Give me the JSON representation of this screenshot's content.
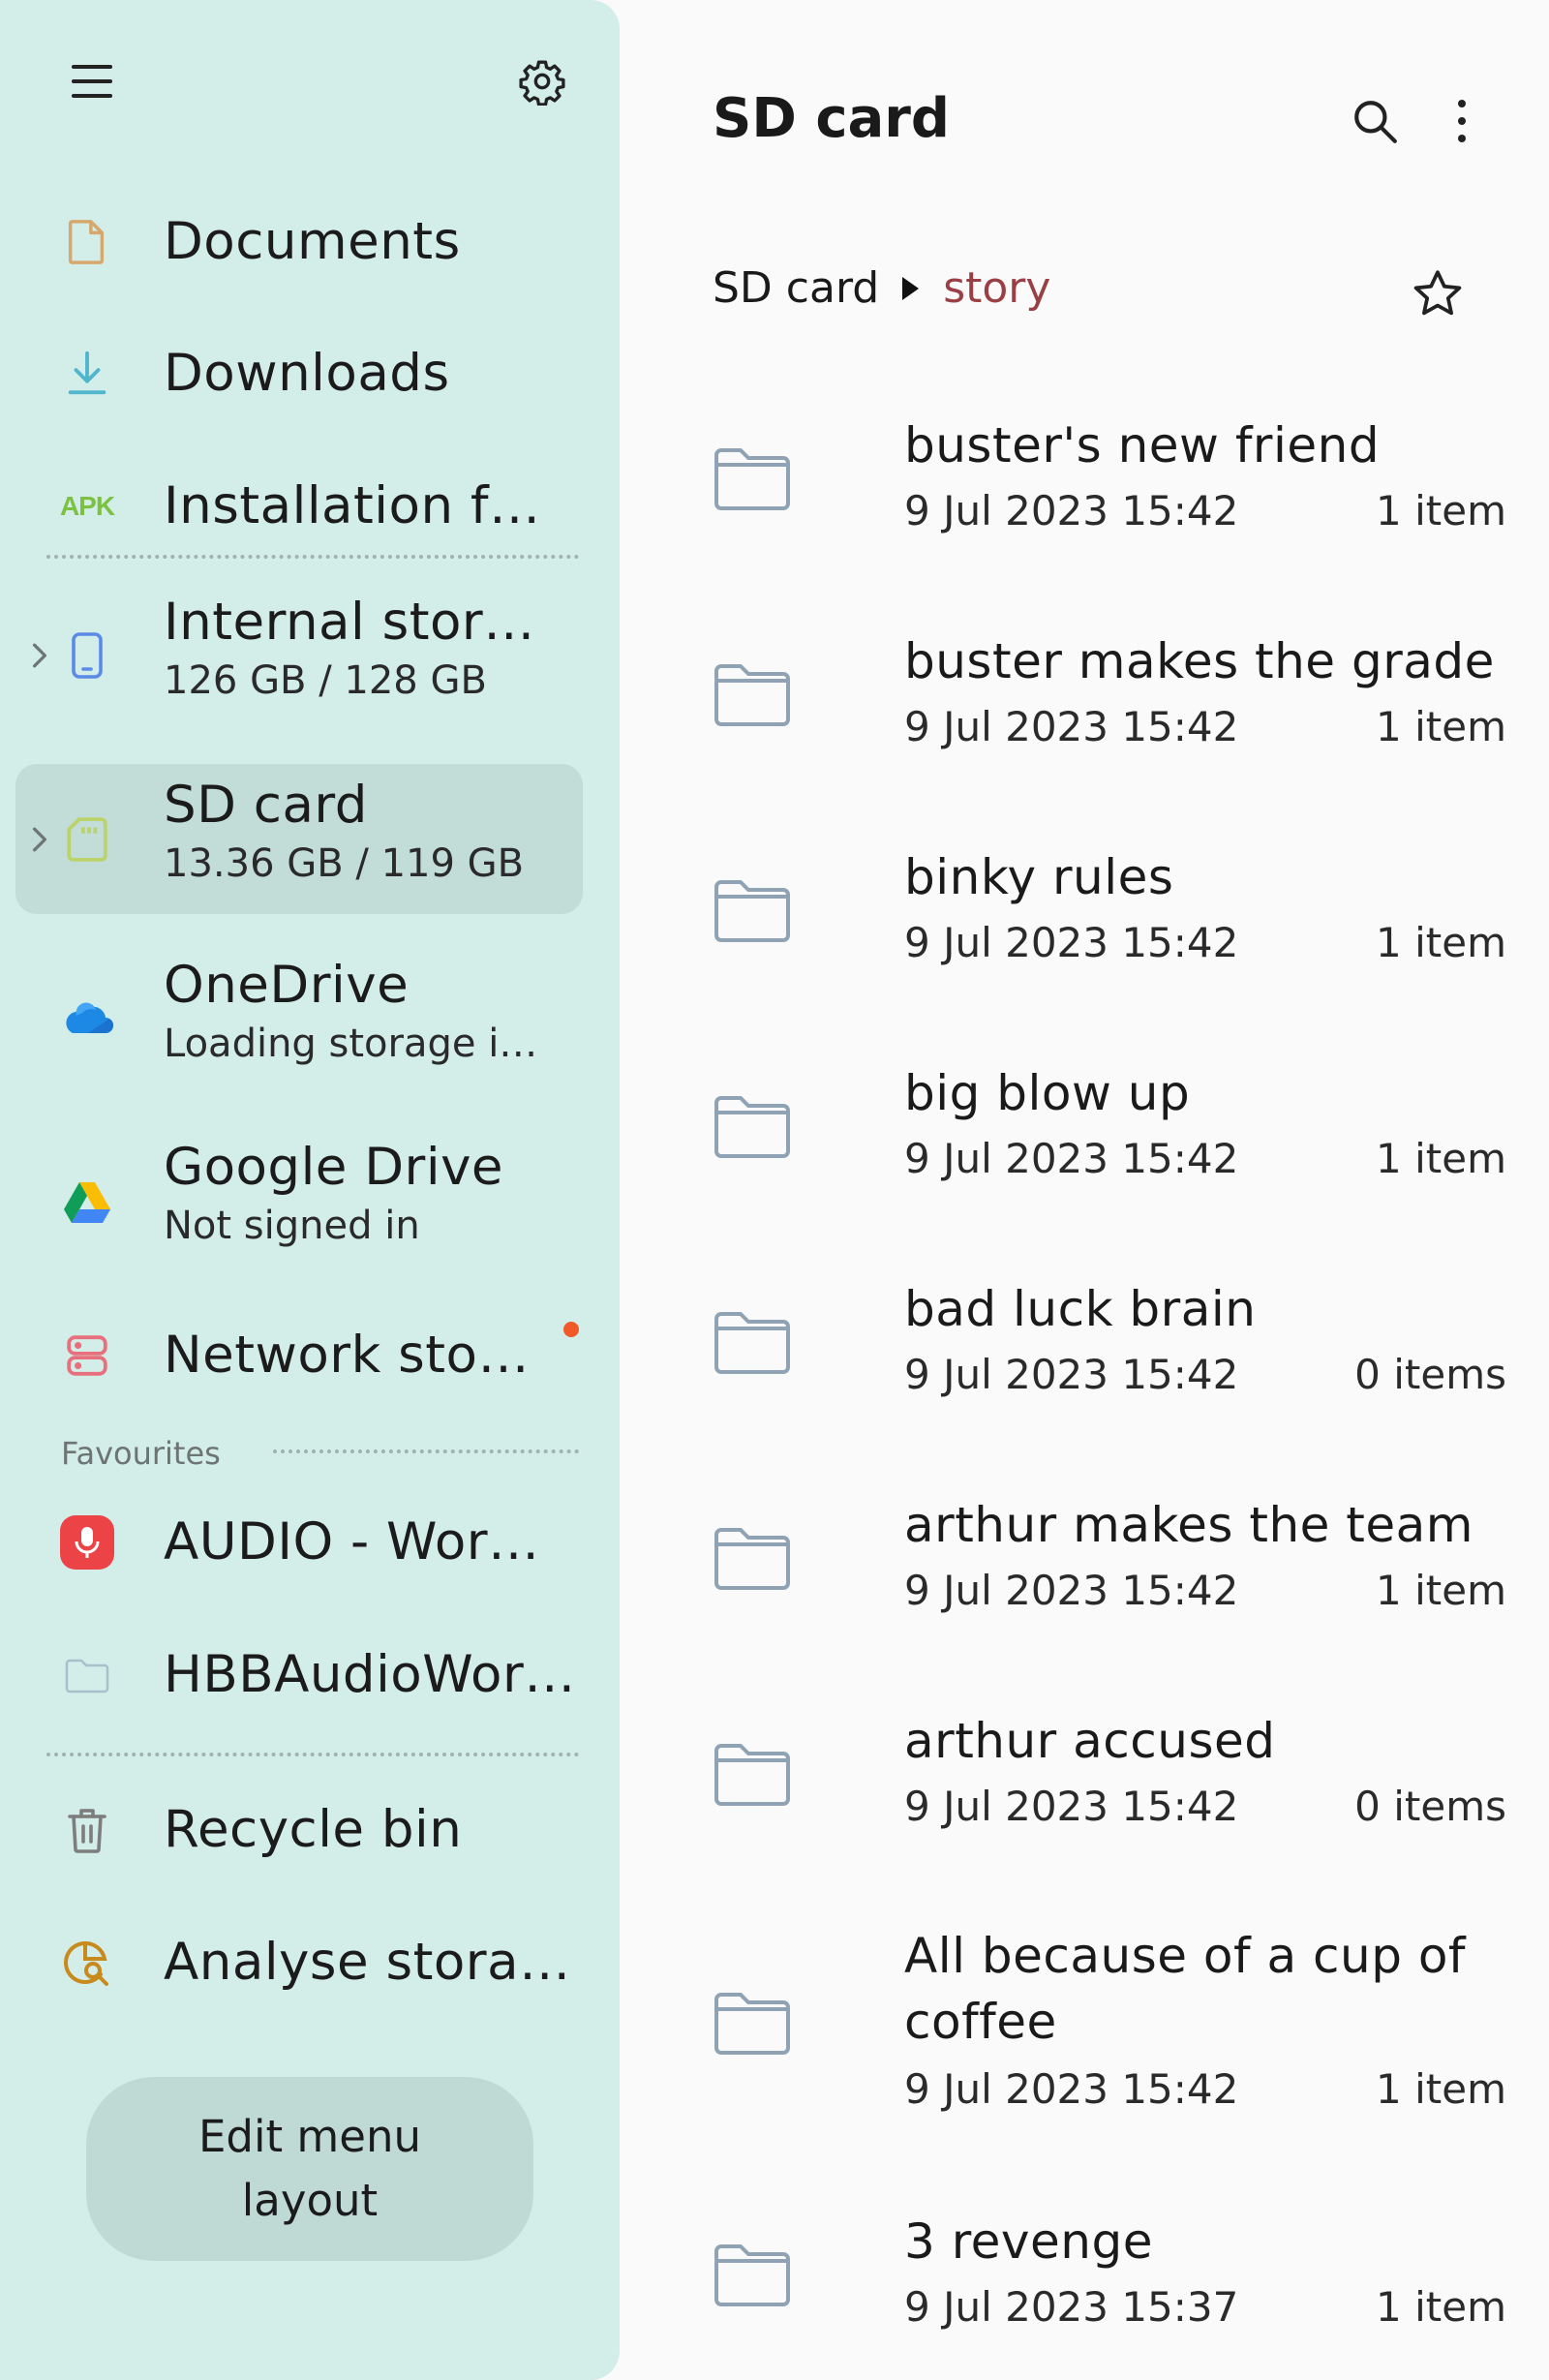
{
  "sidebar": {
    "top": {
      "menu_icon": "hamburger-menu-icon",
      "settings_icon": "gear-icon"
    },
    "quick": [
      {
        "label": "Documents",
        "icon": "document-icon"
      },
      {
        "label": "Downloads",
        "icon": "download-icon"
      },
      {
        "label": "Installation f…",
        "icon": "apk-icon",
        "icon_text": "APK"
      }
    ],
    "storage": [
      {
        "label": "Internal stor…",
        "sub": "126 GB / 128 GB",
        "icon": "phone-icon"
      },
      {
        "label": "SD card",
        "sub": "13.36 GB / 119 GB",
        "icon": "sd-card-icon",
        "selected": true
      },
      {
        "label": "OneDrive",
        "sub": "Loading storage i…",
        "icon": "onedrive-icon"
      },
      {
        "label": "Google Drive",
        "sub": "Not signed in",
        "icon": "google-drive-icon"
      },
      {
        "label": "Network sto…",
        "icon": "network-storage-icon"
      }
    ],
    "favourites_label": "Favourites",
    "favourites": [
      {
        "label": "AUDIO - Wor…",
        "icon": "microphone-icon"
      },
      {
        "label": "HBBAudioWor…",
        "icon": "folder-icon"
      }
    ],
    "bottom": [
      {
        "label": "Recycle bin",
        "icon": "trash-icon"
      },
      {
        "label": "Analyse stora…",
        "icon": "analyse-storage-icon"
      }
    ],
    "edit_layout_line1": "Edit menu",
    "edit_layout_line2": "layout"
  },
  "main": {
    "title": "SD card",
    "breadcrumb": [
      "SD card",
      "story"
    ],
    "items": [
      {
        "name": "buster's new friend",
        "date": "9 Jul 2023 15:42",
        "count": "1 item"
      },
      {
        "name": "buster makes the grade",
        "date": "9 Jul 2023 15:42",
        "count": "1 item"
      },
      {
        "name": "binky rules",
        "date": "9 Jul 2023 15:42",
        "count": "1 item"
      },
      {
        "name": "big blow up",
        "date": "9 Jul 2023 15:42",
        "count": "1 item"
      },
      {
        "name": "bad luck brain",
        "date": "9 Jul 2023 15:42",
        "count": "0 items"
      },
      {
        "name": "arthur makes the team",
        "date": "9 Jul 2023 15:42",
        "count": "1 item"
      },
      {
        "name": "arthur accused",
        "date": "9 Jul 2023 15:42",
        "count": "0 items"
      },
      {
        "name": "All because of a cup of",
        "name2": "coffee",
        "date": "9 Jul 2023 15:42",
        "count": "1 item"
      },
      {
        "name": "3 revenge",
        "date": "9 Jul 2023 15:37",
        "count": "1 item"
      }
    ]
  },
  "colors": {
    "sidebar_bg": "#d3ede9",
    "selected_bg": "#c2dcd8",
    "breadcrumb_current": "#9a4044",
    "folder_stroke": "#8fa3b4",
    "notification_dot": "#f05a28"
  }
}
